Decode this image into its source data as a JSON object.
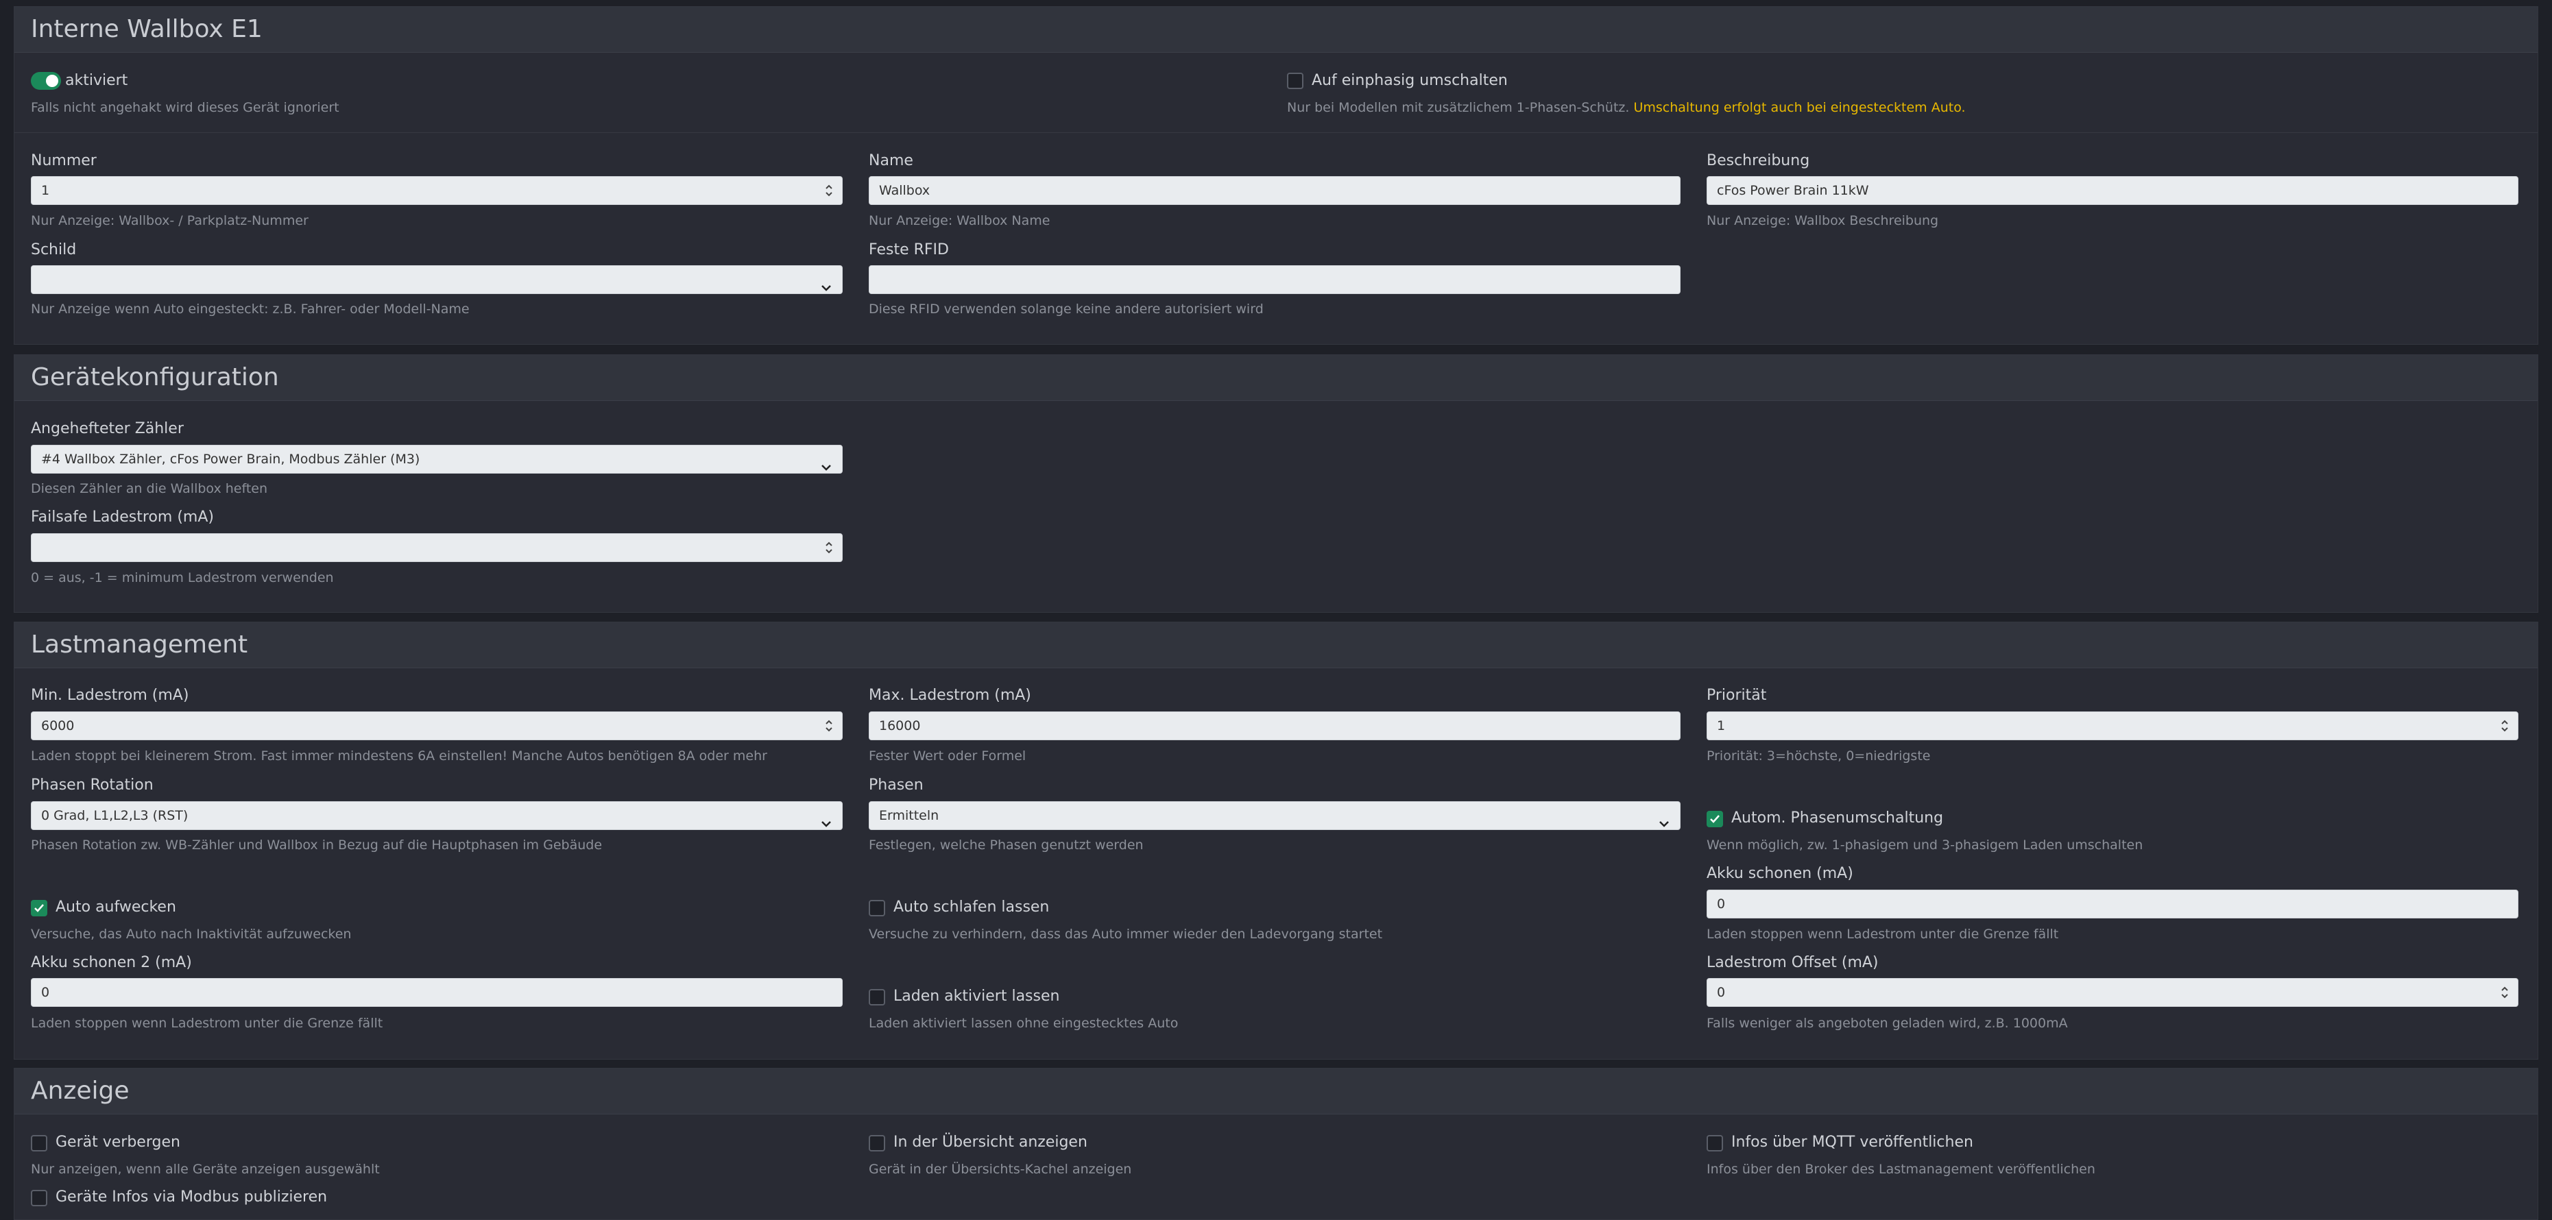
{
  "wallbox": {
    "title": "Interne Wallbox E1",
    "active_label": "aktiviert",
    "active_hint": "Falls nicht angehakt wird dieses Gerät ignoriert",
    "phase_switch_label": "Auf einphasig umschalten",
    "phase_switch_hint": "Nur bei Modellen mit zusätzlichem 1-Phasen-Schütz.",
    "phase_switch_warning": "Umschaltung erfolgt auch bei eingestecktem Auto.",
    "number_label": "Nummer",
    "number_value": "1",
    "number_hint": "Nur Anzeige: Wallbox- / Parkplatz-Nummer",
    "name_label": "Name",
    "name_value": "Wallbox",
    "name_hint": "Nur Anzeige: Wallbox Name",
    "desc_label": "Beschreibung",
    "desc_value": "cFos Power Brain 11kW",
    "desc_hint": "Nur Anzeige: Wallbox Beschreibung",
    "sign_label": "Schild",
    "sign_value": "",
    "sign_hint": "Nur Anzeige wenn Auto eingesteckt: z.B. Fahrer- oder Modell-Name",
    "rfid_label": "Feste RFID",
    "rfid_value": "",
    "rfid_hint": "Diese RFID verwenden solange keine andere autorisiert wird"
  },
  "device_config": {
    "title": "Gerätekonfiguration",
    "meter_label": "Angehefteter Zähler",
    "meter_value": "#4 Wallbox Zähler, cFos Power Brain, Modbus Zähler (M3)",
    "meter_hint": "Diesen Zähler an die Wallbox heften",
    "failsafe_label": "Failsafe Ladestrom (mA)",
    "failsafe_value": "",
    "failsafe_hint": "0 = aus, -1 = minimum Ladestrom verwenden"
  },
  "load_mgmt": {
    "title": "Lastmanagement",
    "min_label": "Min. Ladestrom (mA)",
    "min_value": "6000",
    "min_hint": "Laden stoppt bei kleinerem Strom. Fast immer mindestens 6A einstellen! Manche Autos benötigen 8A oder mehr",
    "max_label": "Max. Ladestrom (mA)",
    "max_value": "16000",
    "max_hint": "Fester Wert oder Formel",
    "prio_label": "Priorität",
    "prio_value": "1",
    "prio_hint": "Priorität: 3=höchste, 0=niedrigste",
    "rotation_label": "Phasen Rotation",
    "rotation_value": "0 Grad, L1,L2,L3 (RST)",
    "rotation_hint": "Phasen Rotation zw. WB-Zähler und Wallbox in Bezug auf die Hauptphasen im Gebäude",
    "phases_label": "Phasen",
    "phases_value": "Ermitteln",
    "phases_hint": "Festlegen, welche Phasen genutzt werden",
    "auto_phase_label": "Autom. Phasenumschaltung",
    "auto_phase_hint": "Wenn möglich, zw. 1-phasigem und 3-phasigem Laden umschalten",
    "wake_label": "Auto aufwecken",
    "wake_hint": "Versuche, das Auto nach Inaktivität aufzuwecken",
    "sleep_label": "Auto schlafen lassen",
    "sleep_hint": "Versuche zu verhindern, dass das Auto immer wieder den Ladevorgang startet",
    "battery_label": "Akku schonen (mA)",
    "battery_value": "0",
    "battery_hint": "Laden stoppen wenn Ladestrom unter die Grenze fällt",
    "battery2_label": "Akku schonen 2 (mA)",
    "battery2_value": "0",
    "battery2_hint": "Laden stoppen wenn Ladestrom unter die Grenze fällt",
    "keep_label": "Laden aktiviert lassen",
    "keep_hint": "Laden aktiviert lassen ohne eingestecktes Auto",
    "offset_label": "Ladestrom Offset (mA)",
    "offset_value": "0",
    "offset_hint": "Falls weniger als angeboten geladen wird, z.B. 1000mA"
  },
  "display": {
    "title": "Anzeige",
    "hide_label": "Gerät verbergen",
    "hide_hint": "Nur anzeigen, wenn alle Geräte anzeigen ausgewählt",
    "overview_label": "In der Übersicht anzeigen",
    "overview_hint": "Gerät in der Übersichts-Kachel anzeigen",
    "mqtt_label": "Infos über MQTT veröffentlichen",
    "mqtt_hint": "Infos über den Broker des Lastmanagement veröffentlichen",
    "modbus_label": "Geräte Infos via Modbus publizieren"
  }
}
